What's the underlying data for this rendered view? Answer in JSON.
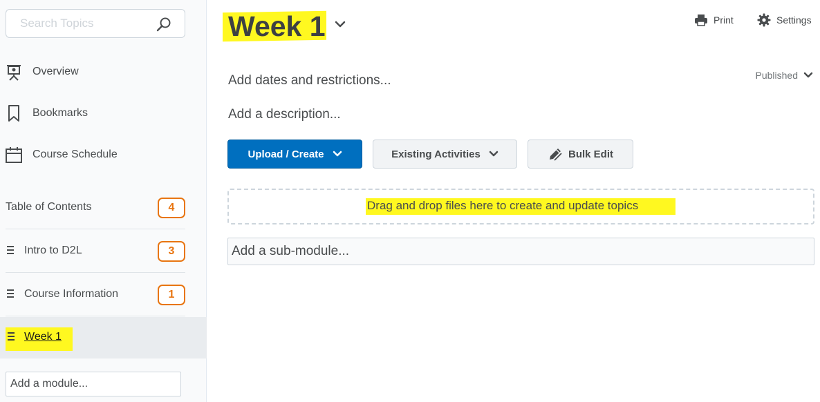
{
  "sidebar": {
    "search": {
      "placeholder": "Search Topics",
      "value": ""
    },
    "nav": [
      {
        "label": "Overview",
        "icon": "presentation-icon"
      },
      {
        "label": "Bookmarks",
        "icon": "bookmark-icon"
      },
      {
        "label": "Course Schedule",
        "icon": "calendar-icon"
      }
    ],
    "toc": {
      "label": "Table of Contents",
      "count": "4"
    },
    "modules": [
      {
        "label": "Intro to D2L",
        "count": "3"
      },
      {
        "label": "Course Information",
        "count": "1"
      },
      {
        "label": "Week 1",
        "count": ""
      }
    ],
    "add_module": {
      "placeholder": "Add a module..."
    }
  },
  "main": {
    "title": "Week 1",
    "actions": {
      "print": "Print",
      "settings": "Settings"
    },
    "add_dates": "Add dates and restrictions...",
    "status": "Published",
    "add_description": "Add a description...",
    "buttons": {
      "upload_create": "Upload / Create",
      "existing_activities": "Existing Activities",
      "bulk_edit": "Bulk Edit"
    },
    "dropzone_text": "Drag and drop files here to create and update topics",
    "add_submodule": {
      "placeholder": "Add a sub-module..."
    }
  },
  "colors": {
    "accent": "#006fbf",
    "badge": "#e87511",
    "highlight": "#fff820",
    "sidebar_bg": "#f9fafb"
  }
}
